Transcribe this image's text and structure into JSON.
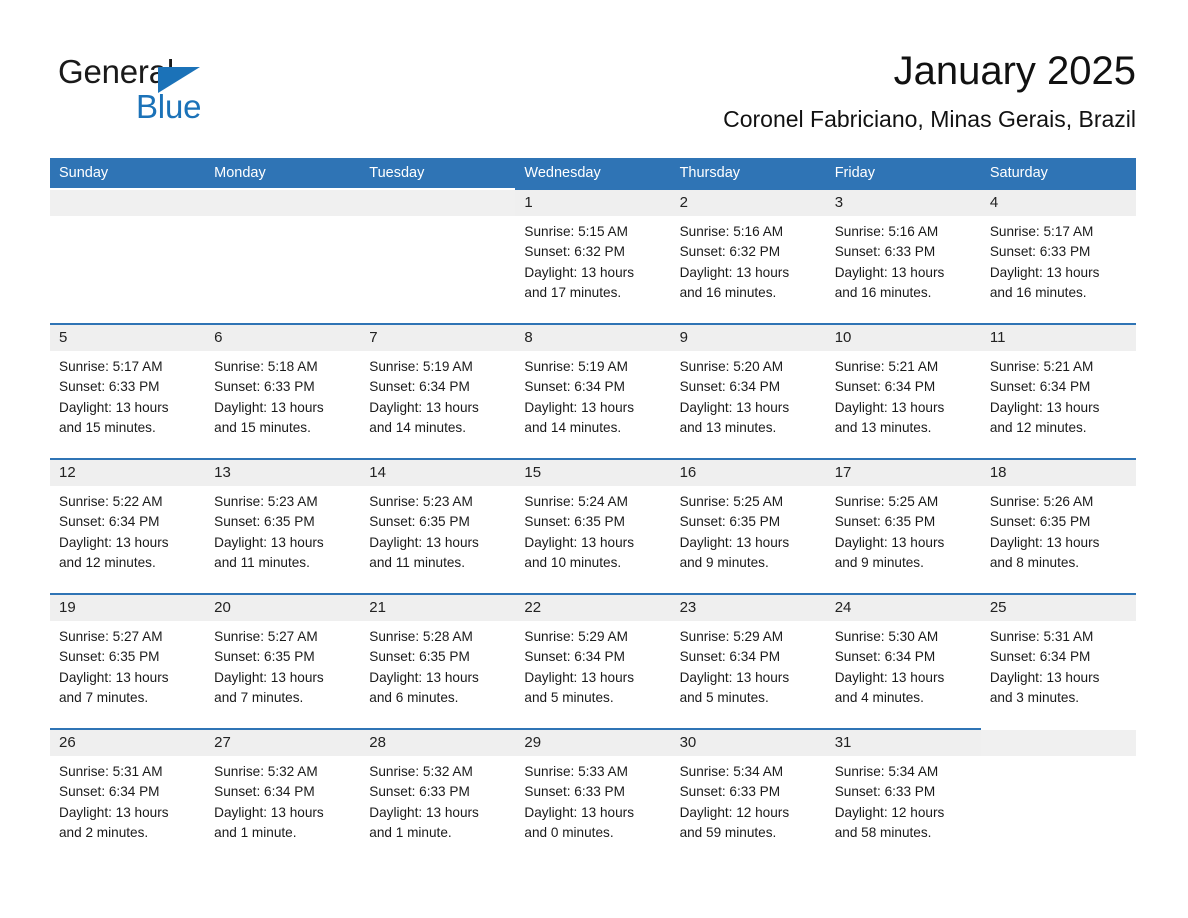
{
  "brand": {
    "name_part1": "General",
    "name_part2": "Blue",
    "logo_icon": "triangle-flag-icon"
  },
  "header": {
    "month_title": "January 2025",
    "location": "Coronel Fabriciano, Minas Gerais, Brazil"
  },
  "colors": {
    "header_blue": "#2f74b5",
    "brand_blue": "#1b72b8",
    "daynum_band": "#efefef",
    "text": "#1a1a1a"
  },
  "weekdays": [
    "Sunday",
    "Monday",
    "Tuesday",
    "Wednesday",
    "Thursday",
    "Friday",
    "Saturday"
  ],
  "weeks": [
    [
      {
        "day": "",
        "empty": true
      },
      {
        "day": "",
        "empty": true
      },
      {
        "day": "",
        "empty": true
      },
      {
        "day": "1",
        "sunrise": "Sunrise: 5:15 AM",
        "sunset": "Sunset: 6:32 PM",
        "daylight1": "Daylight: 13 hours",
        "daylight2": "and 17 minutes."
      },
      {
        "day": "2",
        "sunrise": "Sunrise: 5:16 AM",
        "sunset": "Sunset: 6:32 PM",
        "daylight1": "Daylight: 13 hours",
        "daylight2": "and 16 minutes."
      },
      {
        "day": "3",
        "sunrise": "Sunrise: 5:16 AM",
        "sunset": "Sunset: 6:33 PM",
        "daylight1": "Daylight: 13 hours",
        "daylight2": "and 16 minutes."
      },
      {
        "day": "4",
        "sunrise": "Sunrise: 5:17 AM",
        "sunset": "Sunset: 6:33 PM",
        "daylight1": "Daylight: 13 hours",
        "daylight2": "and 16 minutes."
      }
    ],
    [
      {
        "day": "5",
        "sunrise": "Sunrise: 5:17 AM",
        "sunset": "Sunset: 6:33 PM",
        "daylight1": "Daylight: 13 hours",
        "daylight2": "and 15 minutes."
      },
      {
        "day": "6",
        "sunrise": "Sunrise: 5:18 AM",
        "sunset": "Sunset: 6:33 PM",
        "daylight1": "Daylight: 13 hours",
        "daylight2": "and 15 minutes."
      },
      {
        "day": "7",
        "sunrise": "Sunrise: 5:19 AM",
        "sunset": "Sunset: 6:34 PM",
        "daylight1": "Daylight: 13 hours",
        "daylight2": "and 14 minutes."
      },
      {
        "day": "8",
        "sunrise": "Sunrise: 5:19 AM",
        "sunset": "Sunset: 6:34 PM",
        "daylight1": "Daylight: 13 hours",
        "daylight2": "and 14 minutes."
      },
      {
        "day": "9",
        "sunrise": "Sunrise: 5:20 AM",
        "sunset": "Sunset: 6:34 PM",
        "daylight1": "Daylight: 13 hours",
        "daylight2": "and 13 minutes."
      },
      {
        "day": "10",
        "sunrise": "Sunrise: 5:21 AM",
        "sunset": "Sunset: 6:34 PM",
        "daylight1": "Daylight: 13 hours",
        "daylight2": "and 13 minutes."
      },
      {
        "day": "11",
        "sunrise": "Sunrise: 5:21 AM",
        "sunset": "Sunset: 6:34 PM",
        "daylight1": "Daylight: 13 hours",
        "daylight2": "and 12 minutes."
      }
    ],
    [
      {
        "day": "12",
        "sunrise": "Sunrise: 5:22 AM",
        "sunset": "Sunset: 6:34 PM",
        "daylight1": "Daylight: 13 hours",
        "daylight2": "and 12 minutes."
      },
      {
        "day": "13",
        "sunrise": "Sunrise: 5:23 AM",
        "sunset": "Sunset: 6:35 PM",
        "daylight1": "Daylight: 13 hours",
        "daylight2": "and 11 minutes."
      },
      {
        "day": "14",
        "sunrise": "Sunrise: 5:23 AM",
        "sunset": "Sunset: 6:35 PM",
        "daylight1": "Daylight: 13 hours",
        "daylight2": "and 11 minutes."
      },
      {
        "day": "15",
        "sunrise": "Sunrise: 5:24 AM",
        "sunset": "Sunset: 6:35 PM",
        "daylight1": "Daylight: 13 hours",
        "daylight2": "and 10 minutes."
      },
      {
        "day": "16",
        "sunrise": "Sunrise: 5:25 AM",
        "sunset": "Sunset: 6:35 PM",
        "daylight1": "Daylight: 13 hours",
        "daylight2": "and 9 minutes."
      },
      {
        "day": "17",
        "sunrise": "Sunrise: 5:25 AM",
        "sunset": "Sunset: 6:35 PM",
        "daylight1": "Daylight: 13 hours",
        "daylight2": "and 9 minutes."
      },
      {
        "day": "18",
        "sunrise": "Sunrise: 5:26 AM",
        "sunset": "Sunset: 6:35 PM",
        "daylight1": "Daylight: 13 hours",
        "daylight2": "and 8 minutes."
      }
    ],
    [
      {
        "day": "19",
        "sunrise": "Sunrise: 5:27 AM",
        "sunset": "Sunset: 6:35 PM",
        "daylight1": "Daylight: 13 hours",
        "daylight2": "and 7 minutes."
      },
      {
        "day": "20",
        "sunrise": "Sunrise: 5:27 AM",
        "sunset": "Sunset: 6:35 PM",
        "daylight1": "Daylight: 13 hours",
        "daylight2": "and 7 minutes."
      },
      {
        "day": "21",
        "sunrise": "Sunrise: 5:28 AM",
        "sunset": "Sunset: 6:35 PM",
        "daylight1": "Daylight: 13 hours",
        "daylight2": "and 6 minutes."
      },
      {
        "day": "22",
        "sunrise": "Sunrise: 5:29 AM",
        "sunset": "Sunset: 6:34 PM",
        "daylight1": "Daylight: 13 hours",
        "daylight2": "and 5 minutes."
      },
      {
        "day": "23",
        "sunrise": "Sunrise: 5:29 AM",
        "sunset": "Sunset: 6:34 PM",
        "daylight1": "Daylight: 13 hours",
        "daylight2": "and 5 minutes."
      },
      {
        "day": "24",
        "sunrise": "Sunrise: 5:30 AM",
        "sunset": "Sunset: 6:34 PM",
        "daylight1": "Daylight: 13 hours",
        "daylight2": "and 4 minutes."
      },
      {
        "day": "25",
        "sunrise": "Sunrise: 5:31 AM",
        "sunset": "Sunset: 6:34 PM",
        "daylight1": "Daylight: 13 hours",
        "daylight2": "and 3 minutes."
      }
    ],
    [
      {
        "day": "26",
        "sunrise": "Sunrise: 5:31 AM",
        "sunset": "Sunset: 6:34 PM",
        "daylight1": "Daylight: 13 hours",
        "daylight2": "and 2 minutes."
      },
      {
        "day": "27",
        "sunrise": "Sunrise: 5:32 AM",
        "sunset": "Sunset: 6:34 PM",
        "daylight1": "Daylight: 13 hours",
        "daylight2": "and 1 minute."
      },
      {
        "day": "28",
        "sunrise": "Sunrise: 5:32 AM",
        "sunset": "Sunset: 6:33 PM",
        "daylight1": "Daylight: 13 hours",
        "daylight2": "and 1 minute."
      },
      {
        "day": "29",
        "sunrise": "Sunrise: 5:33 AM",
        "sunset": "Sunset: 6:33 PM",
        "daylight1": "Daylight: 13 hours",
        "daylight2": "and 0 minutes."
      },
      {
        "day": "30",
        "sunrise": "Sunrise: 5:34 AM",
        "sunset": "Sunset: 6:33 PM",
        "daylight1": "Daylight: 12 hours",
        "daylight2": "and 59 minutes."
      },
      {
        "day": "31",
        "sunrise": "Sunrise: 5:34 AM",
        "sunset": "Sunset: 6:33 PM",
        "daylight1": "Daylight: 12 hours",
        "daylight2": "and 58 minutes."
      },
      {
        "day": "",
        "empty": true
      }
    ]
  ]
}
